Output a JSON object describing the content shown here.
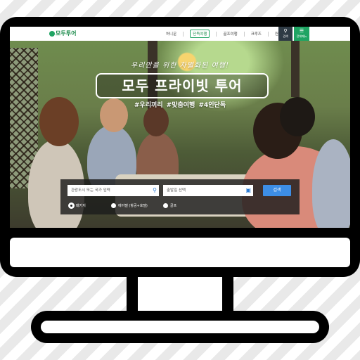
{
  "site": {
    "logo_text": "모두투어"
  },
  "nav": {
    "items": [
      "허니문",
      "단독여행",
      "골프여행",
      "크루즈",
      "컨셉투어"
    ],
    "active_item": "단독여행",
    "search_label": "검색",
    "menu_label": "전체메뉴"
  },
  "hero": {
    "subtitle": "우리만을 위한 차별화된 여행!",
    "title": "모두 프라이빗 투어",
    "tags": "#우리끼리  #맞춤여행  #4인단독"
  },
  "search": {
    "destination_placeholder": "관광도시 또는 국가 입력",
    "date_placeholder": "출발일 선택",
    "submit_label": "검색",
    "options": [
      "패키지",
      "에어텔 (항공+호텔)",
      "골프"
    ],
    "selected_option": "패키지"
  },
  "colors": {
    "brand": "#1fa463",
    "accent": "#3d8ee6",
    "search_tile": "#2f3b45"
  },
  "icons": {
    "search": "search-icon",
    "menu": "hamburger-icon",
    "calendar": "calendar-icon"
  }
}
